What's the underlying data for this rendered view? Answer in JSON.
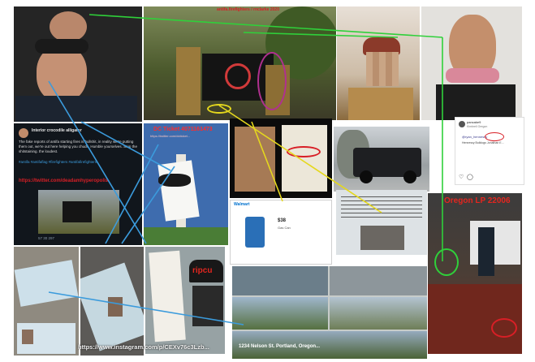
{
  "collage": {
    "tweet_panel": {
      "username": "Interior crocodile alligator",
      "body": "The fake reports of antifa starting fires is bullshit, in reality we're putting them out, we're out here helping you chuds. Humble yourselves. Stop the shitstaining. the loudest.",
      "hashtags": "#antifa #antifaflag #firefighters #antifafirefighters",
      "link": "https://twitter.com/deadamhyperopolis",
      "stats": "57   30   297"
    },
    "dc_ticket_panel": {
      "heading": "DC Ticket 4071161473",
      "subheading": "https://twitter.com/dcticket..."
    },
    "listing_panel": {
      "site": "Walmart",
      "price": "$38",
      "product_title": "Gas Can"
    },
    "instagram_panel": {
      "username": "pancake9",
      "location": "Kimbrell Oregon",
      "mention": "@ryan_hennessy",
      "caption": "Hennessy Bulldogs Jonathan E..."
    },
    "oregon_plate_panel": {
      "heading": "Oregon LP 22006"
    },
    "ripcurl_panel": {
      "brand": "ripcu"
    },
    "instagram_url": "https://www.instagram.com/p/CEXv76c3Lzb...",
    "street_address": "1234 Nelson St. Portland, Oregon..."
  },
  "colors": {
    "annotation_red": "#d81f26",
    "link_blue": "#3b9bdc",
    "link_green": "#2fd03a",
    "link_yellow": "#e5d81d",
    "circle_magenta": "#b0308f"
  }
}
